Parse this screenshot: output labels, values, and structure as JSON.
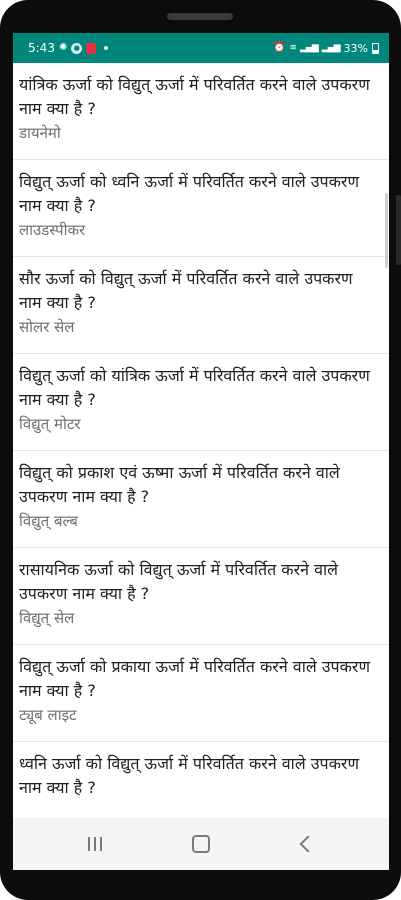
{
  "status_bar": {
    "time": "5:43",
    "battery": "33%"
  },
  "items": [
    {
      "question": "यांत्रिक ऊर्जा को विद्युत् ऊर्जा में परिवर्तित करने वाले उपकरण नाम क्या है ?",
      "answer": "डायनेमो"
    },
    {
      "question": "विद्युत् ऊर्जा को ध्वनि ऊर्जा में परिवर्तित करने वाले उपकरण नाम क्या है ?",
      "answer": "लाउडस्पीकर"
    },
    {
      "question": "सौर ऊर्जा को विद्युत् ऊर्जा में परिवर्तित करने वाले उपकरण नाम क्या है ?",
      "answer": "सोलर सेल"
    },
    {
      "question": "विद्युत् ऊर्जा को यांत्रिक ऊर्जा में परिवर्तित करने वाले उपकरण नाम क्या है ?",
      "answer": "विद्युत् मोटर"
    },
    {
      "question": "विद्युत् को प्रकाश एवं ऊष्मा ऊर्जा में परिवर्तित करने वाले उपकरण नाम क्या है ?",
      "answer": "विद्युत् बल्ब"
    },
    {
      "question": "रासायनिक ऊर्जा को विद्युत् ऊर्जा में परिवर्तित करने वाले उपकरण नाम क्या है ?",
      "answer": "विद्युत् सेल"
    },
    {
      "question": "विद्युत् ऊर्जा को प्रकाया ऊर्जा में परिवर्तित करने वाले उपकरण नाम क्या है ?",
      "answer": "ट्यूब लाइट"
    },
    {
      "question": "ध्वनि ऊर्जा को विद्युत् ऊर्जा में परिवर्तित करने वाले उपकरण नाम क्या है ?",
      "answer": ""
    }
  ],
  "icons": {
    "recents": "recents-icon",
    "home": "home-icon",
    "back": "back-icon"
  }
}
